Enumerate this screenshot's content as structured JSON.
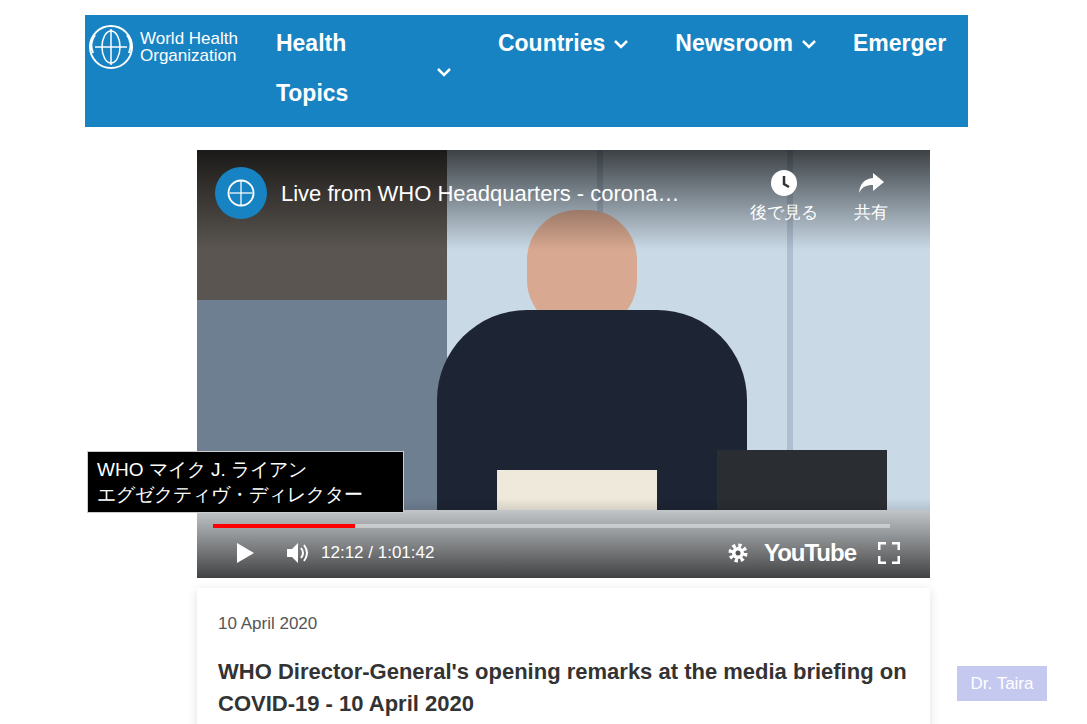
{
  "header": {
    "logo": [
      "World Health",
      "Organization"
    ],
    "nav": [
      {
        "label": "Health Topics",
        "kind": "stacked"
      },
      {
        "label": "Countries",
        "kind": "menu"
      },
      {
        "label": "Newsroom",
        "kind": "menu"
      },
      {
        "label": "Emerger",
        "kind": "clipped"
      }
    ]
  },
  "video": {
    "title": "Live from WHO Headquarters - corona…",
    "watch_later": "後で見る",
    "share": "共有",
    "progress": {
      "level": 0.21
    },
    "time": "12:12 / 1:01:42",
    "brand": "YouTube"
  },
  "caption": [
    "WHO マイク J. ライアン",
    "エグゼクティヴ・ディレクター"
  ],
  "article": {
    "date": "10 April 2020",
    "title": "WHO Director-General's opening remarks at the media briefing on COVID-19 - 10 April 2020"
  },
  "badge": "Dr. Taira"
}
